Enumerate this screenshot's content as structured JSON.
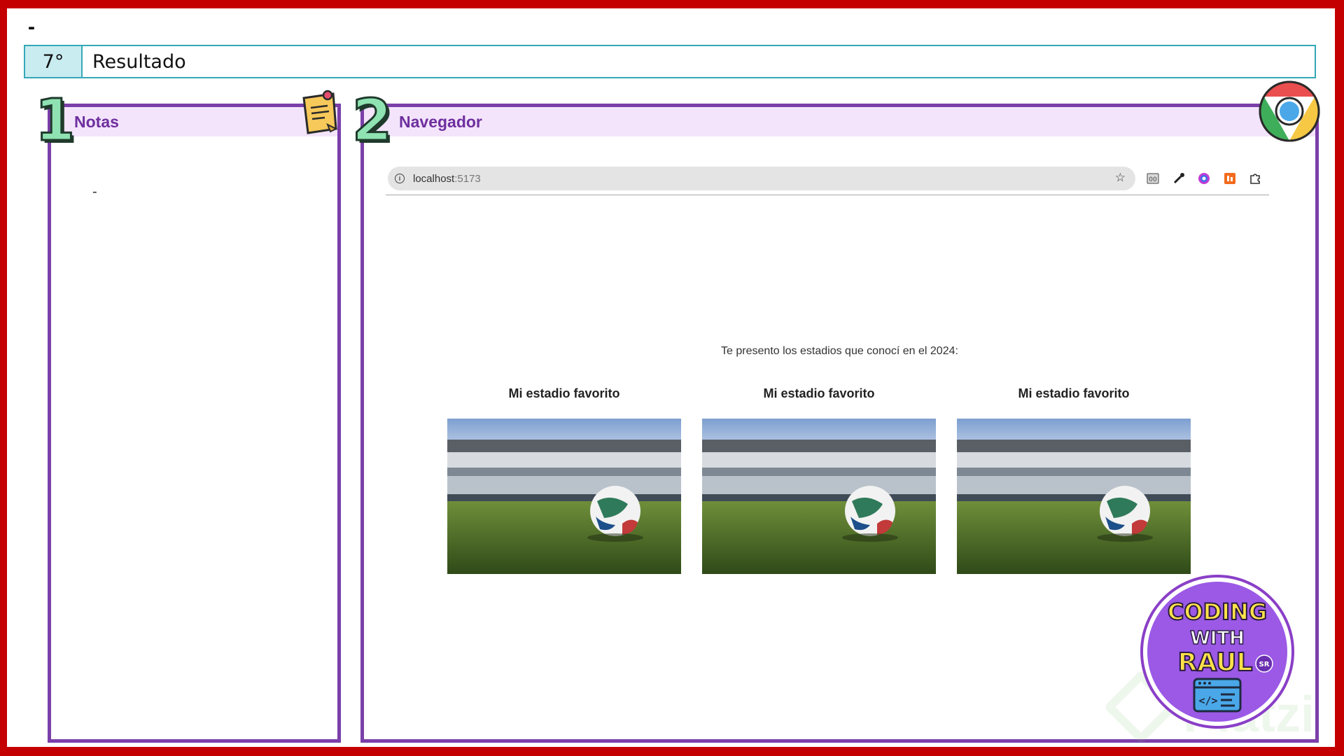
{
  "top": {
    "dash": "-"
  },
  "header": {
    "step": "7°",
    "title": "Resultado"
  },
  "notes_panel": {
    "number": "1",
    "title": "Notas",
    "content": "-"
  },
  "browser_panel": {
    "number": "2",
    "title": "Navegador"
  },
  "browser": {
    "url_host": "localhost",
    "url_port": ":5173",
    "extensions": [
      "inspect-extension-icon",
      "eyedropper-icon",
      "color-picker-icon",
      "calendar-extension-icon",
      "extensions-puzzle-icon"
    ]
  },
  "page": {
    "intro": "Te presento los estadios que conocí en el 2024:",
    "cards": [
      {
        "title": "Mi estadio favorito"
      },
      {
        "title": "Mi estadio favorito"
      },
      {
        "title": "Mi estadio favorito"
      }
    ]
  },
  "badge": {
    "line1": "CODING",
    "line2": "WITH",
    "line3": "RAUL",
    "tag": "SR"
  },
  "watermark": {
    "text": "Platzi"
  },
  "colors": {
    "frame": "#c50000",
    "panel_border": "#7b3fa9",
    "panel_header_bg": "#f3e4fb",
    "header_border": "#35a8b8",
    "header_step_bg": "#c9ecf1"
  }
}
